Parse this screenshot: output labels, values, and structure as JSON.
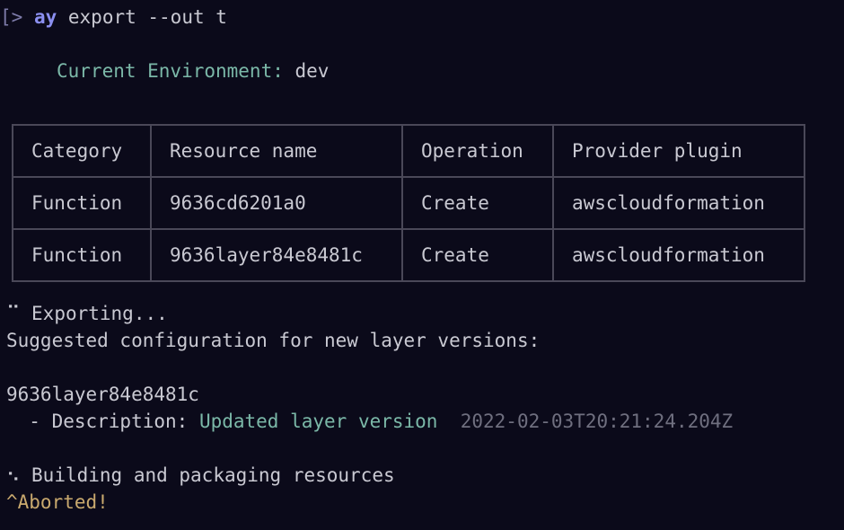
{
  "terminal": {
    "prompt_symbol": "[>",
    "command_name": "ay",
    "command_args": " export --out t",
    "environment_label": "Current Environment:",
    "environment_value": " dev",
    "table": {
      "headers": [
        "Category",
        "Resource name",
        "Operation",
        "Provider plugin"
      ],
      "rows": [
        [
          "Function",
          "9636cd6201a0",
          "Create",
          "awscloudformation"
        ],
        [
          "Function",
          "9636layer84e8481c",
          "Create",
          "awscloudformation"
        ]
      ]
    },
    "exporting_spinner": "⠉",
    "exporting_text": " Exporting...",
    "suggested_text": "Suggested configuration for new layer versions:",
    "layer_name": "9636layer84e8481c",
    "description_prefix": "  - Description: ",
    "description_value": "Updated layer version",
    "description_timestamp": "  2022-02-03T20:21:24.204Z",
    "building_spinner": "⠢",
    "building_text": " Building and packaging resources",
    "aborted_text": "^Aborted!"
  }
}
